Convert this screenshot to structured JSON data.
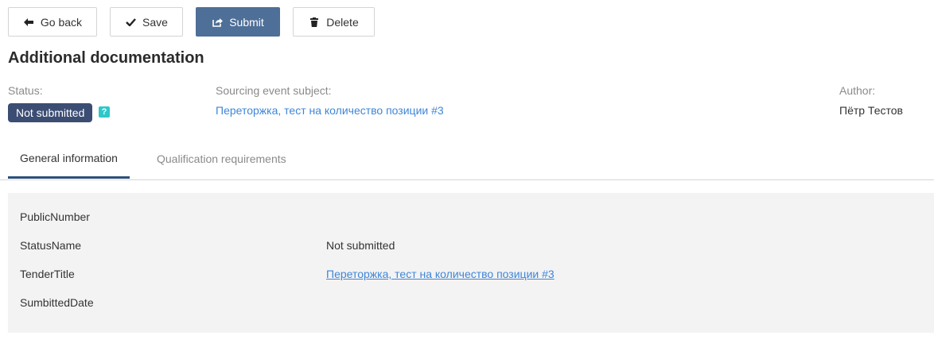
{
  "toolbar": {
    "back_label": "Go back",
    "save_label": "Save",
    "submit_label": "Submit",
    "delete_label": "Delete"
  },
  "page": {
    "title": "Additional documentation"
  },
  "meta": {
    "status_label": "Status:",
    "status_value": "Not submitted",
    "help_glyph": "?",
    "subject_label": "Sourcing event subject:",
    "subject_value": "Переторжка, тест на количество позиции #3",
    "author_label": "Author:",
    "author_value": "Пётр Тестов"
  },
  "tabs": [
    {
      "label": "General information",
      "active": true
    },
    {
      "label": "Qualification requirements",
      "active": false
    }
  ],
  "info": {
    "rows": [
      {
        "label": "PublicNumber",
        "value": ""
      },
      {
        "label": "StatusName",
        "value": "Not submitted"
      },
      {
        "label": "TenderTitle",
        "value": "Переторжка, тест на количество позиции #3"
      },
      {
        "label": "SumbittedDate",
        "value": ""
      }
    ]
  },
  "colors": {
    "primary_button": "#4e6f97",
    "status_badge": "#3b4d73",
    "help_icon": "#2ec8c8",
    "link": "#3f86d8",
    "active_tab_underline": "#2c4f7c"
  }
}
